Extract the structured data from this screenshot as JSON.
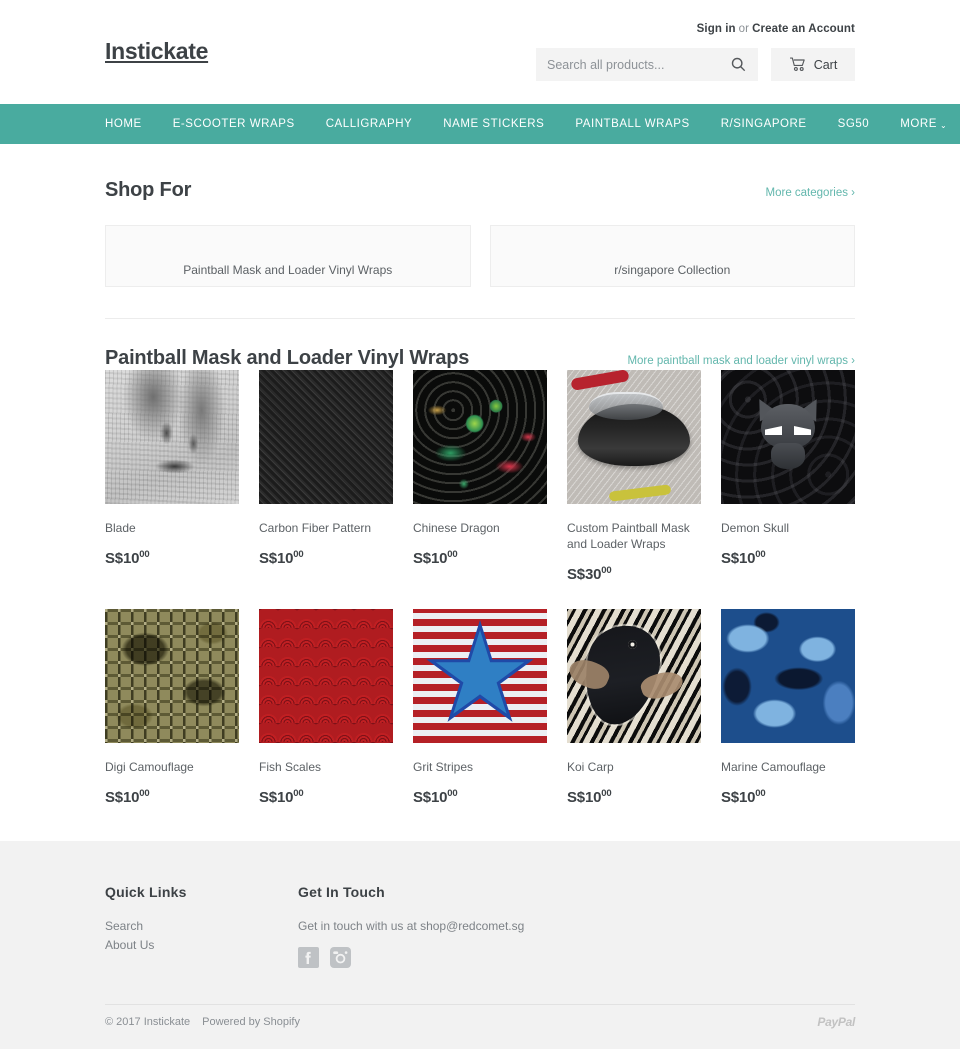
{
  "header": {
    "logo": "Instickate",
    "sign_in": "Sign in",
    "or": "or",
    "create_account": "Create an Account",
    "search_placeholder": "Search all products...",
    "search_value": "",
    "search_icon": "search-icon",
    "cart_label": "Cart",
    "cart_icon": "shopping-cart-icon"
  },
  "nav": {
    "items": [
      {
        "label": "HOME",
        "has_chevron": false
      },
      {
        "label": "E-SCOOTER WRAPS",
        "has_chevron": false
      },
      {
        "label": "CALLIGRAPHY",
        "has_chevron": false
      },
      {
        "label": "NAME STICKERS",
        "has_chevron": false
      },
      {
        "label": "PAINTBALL WRAPS",
        "has_chevron": false
      },
      {
        "label": "R/SINGAPORE",
        "has_chevron": false
      },
      {
        "label": "SG50",
        "has_chevron": false
      },
      {
        "label": "MORE",
        "has_chevron": true
      }
    ],
    "chevron": "⌄",
    "background_color": "#49ab9f"
  },
  "shop_for": {
    "title": "Shop For",
    "more_link": "More categories ›",
    "categories": [
      {
        "label": "Paintball Mask and Loader Vinyl Wraps"
      },
      {
        "label": "r/singapore Collection"
      }
    ]
  },
  "collection": {
    "title": "Paintball Mask and Loader Vinyl Wraps",
    "more_link": "More paintball mask and loader vinyl wraps ›",
    "products": [
      {
        "title": "Blade",
        "price": "S$10",
        "cents": "00",
        "art": "th-blade"
      },
      {
        "title": "Carbon Fiber Pattern",
        "price": "S$10",
        "cents": "00",
        "art": "th-carbon"
      },
      {
        "title": "Chinese Dragon",
        "price": "S$10",
        "cents": "00",
        "art": "th-dragon"
      },
      {
        "title": "Custom Paintball Mask and Loader Wraps",
        "price": "S$30",
        "cents": "00",
        "art": "th-custom"
      },
      {
        "title": "Demon Skull",
        "price": "S$10",
        "cents": "00",
        "art": "th-skull"
      },
      {
        "title": "Digi Camouflage",
        "price": "S$10",
        "cents": "00",
        "art": "th-digicam"
      },
      {
        "title": "Fish Scales",
        "price": "S$10",
        "cents": "00",
        "art": "th-fish"
      },
      {
        "title": "Grit Stripes",
        "price": "S$10",
        "cents": "00",
        "art": "th-grit"
      },
      {
        "title": "Koi Carp",
        "price": "S$10",
        "cents": "00",
        "art": "th-koi"
      },
      {
        "title": "Marine Camouflage",
        "price": "S$10",
        "cents": "00",
        "art": "th-marine"
      }
    ]
  },
  "footer": {
    "quick_links_title": "Quick Links",
    "quick_links": [
      {
        "label": "Search"
      },
      {
        "label": "About Us"
      }
    ],
    "get_in_touch_title": "Get In Touch",
    "get_in_touch_text": "Get in touch with us at shop@redcomet.sg",
    "socials": [
      {
        "name": "facebook-icon"
      },
      {
        "name": "instagram-icon"
      }
    ],
    "copyright": "© 2017 Instickate",
    "powered_by": "Powered by Shopify",
    "payment_logo": "PayPal"
  }
}
